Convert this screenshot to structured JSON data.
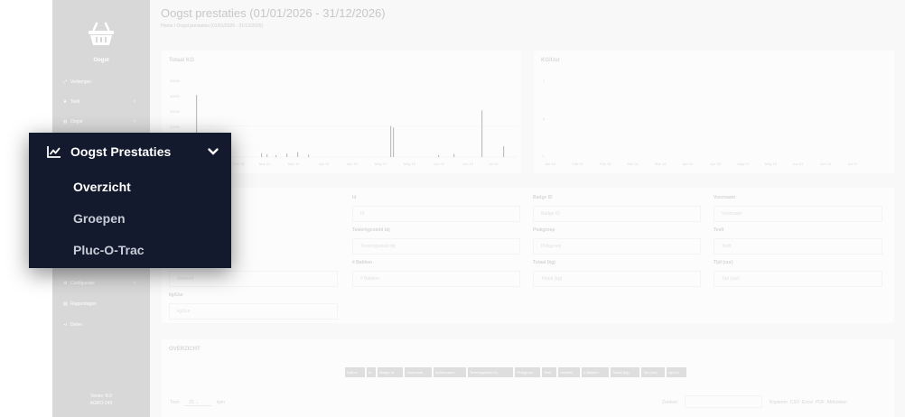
{
  "sidebar": {
    "app_name": "Oogst",
    "items": [
      {
        "label": "Verbergen",
        "icon": "compress-icon",
        "chevron": ""
      },
      {
        "label": "Teelt",
        "icon": "leaf-icon",
        "chevron": "‹"
      },
      {
        "label": "Oogst",
        "icon": "basket-icon",
        "chevron": "‹"
      }
    ],
    "lower_items": [
      {
        "label": "Configuratie",
        "icon": "gear-icon",
        "chevron": "‹"
      },
      {
        "label": "Rapportages",
        "icon": "file-icon",
        "chevron": ""
      },
      {
        "label": "Delen",
        "icon": "share-icon",
        "chevron": ""
      }
    ],
    "version_line1": "Versie: 8.0",
    "version_line2": "AGRO-240"
  },
  "header": {
    "title": "Oogst prestaties (01/01/2026 - 31/12/2026)",
    "breadcrumb": "Home  /  Oogst prestaties (01/01/2026 - 31/12/2026)"
  },
  "chart_data": [
    {
      "type": "bar",
      "title": "Totaal KG",
      "yticks": [
        "50000",
        "40000",
        "30000",
        "20000"
      ],
      "xticks": [
        "Feb 15",
        "Mar 01",
        "Mar 16",
        "Apr 01",
        "Apr 16",
        "May 01",
        "May 16",
        "Jun 01",
        "Jun 16",
        "Jul 01"
      ],
      "ylim": [
        0,
        50000
      ],
      "values": [
        40000,
        2500,
        1800,
        1200,
        2200,
        3200,
        1500,
        20000,
        19000,
        1200,
        2000,
        30000,
        7000
      ]
    },
    {
      "type": "bar",
      "title": "KG/Uur",
      "yticks": [
        "1",
        "0",
        "-1"
      ],
      "xticks": [
        "Jan 16",
        "Feb 01",
        "Feb 16",
        "Mar 01",
        "Mar 16",
        "Apr 01",
        "Apr 16",
        "May 01",
        "May 16",
        "Jun 01",
        "Jun 16",
        "Jul 01"
      ],
      "ylim": [
        -1,
        1
      ],
      "values": []
    }
  ],
  "filters": {
    "id_label": "Id",
    "id_placeholder": "Id",
    "badge_label": "Badge ID",
    "badge_placeholder": "Badge ID",
    "voornaam_label": "Voornaam",
    "voornaam_placeholder": "Voornaam",
    "tewerk_label": "Tewerkgesteld bij",
    "tewerk_placeholder": "Tewerkgesteld bij",
    "plukgroep_label": "Plukgroep",
    "plukgroep_placeholder": "Plukgroep",
    "teelt_label": "Teelt",
    "teelt_placeholder": "Teelt",
    "variety_placeholder": "Varieteit",
    "bakken_label": "# Bakken",
    "bakken_placeholder": "# Bakken",
    "totaal_label": "Totaal (kg)",
    "totaal_placeholder": "Totaal (kg)",
    "tijd_label": "Tijd (uur)",
    "tijd_placeholder": "Tijd (uur)",
    "kguur_label": "kg/Uur",
    "kguur_placeholder": "kg/Uur"
  },
  "overview": {
    "title": "OVERZICHT",
    "columns": [
      "Datum",
      "Id",
      "Badge Id",
      "Voornaam",
      "Achternaam",
      "Tewerkgesteld bij",
      "Plukgroep",
      "Teelt",
      "Varieteit",
      "# Bakken",
      "Totaal (kg)",
      "Tijd (uur)",
      "kg/Uur"
    ],
    "toon": "Toon",
    "page_size": "25",
    "rijen": "rijen",
    "zoeken": "Zoeken:",
    "exports": [
      "Kopieren",
      "CSV",
      "Excel",
      "PDF",
      "Afdrukken"
    ]
  },
  "popup": {
    "title": "Oogst Prestaties",
    "items": [
      "Overzicht",
      "Groepen",
      "Pluc-O-Trac"
    ],
    "active_color": "#ffffff",
    "inactive_color": "#c8ccd6",
    "bg_color": "#131a2e"
  }
}
